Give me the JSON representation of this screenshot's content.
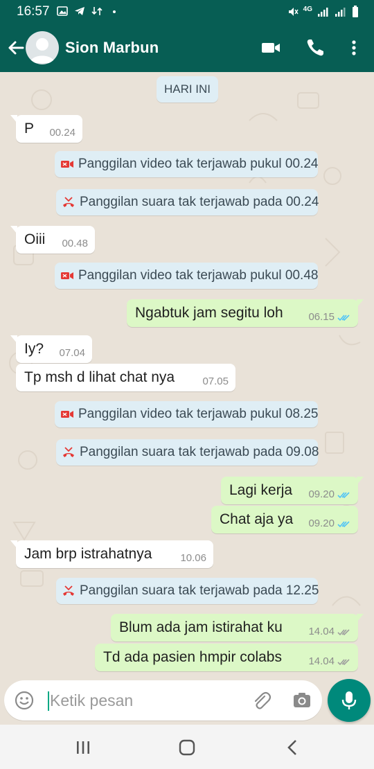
{
  "status_bar": {
    "time": "16:57",
    "network": "4G"
  },
  "header": {
    "contact_name": "Sion Marbun",
    "back_icon": "arrow-left-icon",
    "video_icon": "video-call-icon",
    "call_icon": "phone-icon",
    "menu_icon": "more-vert-icon"
  },
  "chat": {
    "date_label": "HARI INI",
    "items": [
      {
        "kind": "in",
        "text": "P",
        "time": "00.24"
      },
      {
        "kind": "sys",
        "icon": "missed-video-icon",
        "text": "Panggilan video tak terjawab pukul 00.24"
      },
      {
        "kind": "sys",
        "icon": "missed-voice-icon",
        "text": "Panggilan suara tak terjawab pada 00.24"
      },
      {
        "kind": "in",
        "text": "Oiii",
        "time": "00.48"
      },
      {
        "kind": "sys",
        "icon": "missed-video-icon",
        "text": "Panggilan video tak terjawab pukul 00.48"
      },
      {
        "kind": "out",
        "text": "Ngabtuk jam segitu loh",
        "time": "06.15",
        "status": "read"
      },
      {
        "kind": "in",
        "text": "Iy?",
        "time": "07.04"
      },
      {
        "kind": "in",
        "text": "Tp msh d lihat chat nya",
        "time": "07.05"
      },
      {
        "kind": "sys",
        "icon": "missed-video-icon",
        "text": "Panggilan video tak terjawab pukul 08.25"
      },
      {
        "kind": "sys",
        "icon": "missed-voice-icon",
        "text": "Panggilan suara tak terjawab pada 09.08"
      },
      {
        "kind": "out",
        "text": "Lagi kerja",
        "time": "09.20",
        "status": "read"
      },
      {
        "kind": "out",
        "text": "Chat aja ya",
        "time": "09.20",
        "status": "read"
      },
      {
        "kind": "in",
        "text": "Jam brp istrahatnya",
        "time": "10.06"
      },
      {
        "kind": "sys",
        "icon": "missed-voice-icon",
        "text": "Panggilan suara tak terjawab pada 12.25"
      },
      {
        "kind": "out",
        "text": "Blum ada jam istirahat ku",
        "time": "14.04",
        "status": "delivered"
      },
      {
        "kind": "out",
        "text": "Td ada pasien hmpir colabs",
        "time": "14.04",
        "status": "delivered"
      }
    ]
  },
  "composer": {
    "placeholder": "Ketik pesan",
    "emoji_icon": "emoji-icon",
    "attach_icon": "paperclip-icon",
    "camera_icon": "camera-icon",
    "mic_icon": "mic-icon"
  },
  "colors": {
    "header": "#075e54",
    "outgoing_bubble": "#dcf8c6",
    "incoming_bubble": "#ffffff",
    "system_bubble": "#dfeef5",
    "read_ticks": "#4fc3f7",
    "missed_call_red": "#e53935",
    "mic_button": "#00897b"
  }
}
